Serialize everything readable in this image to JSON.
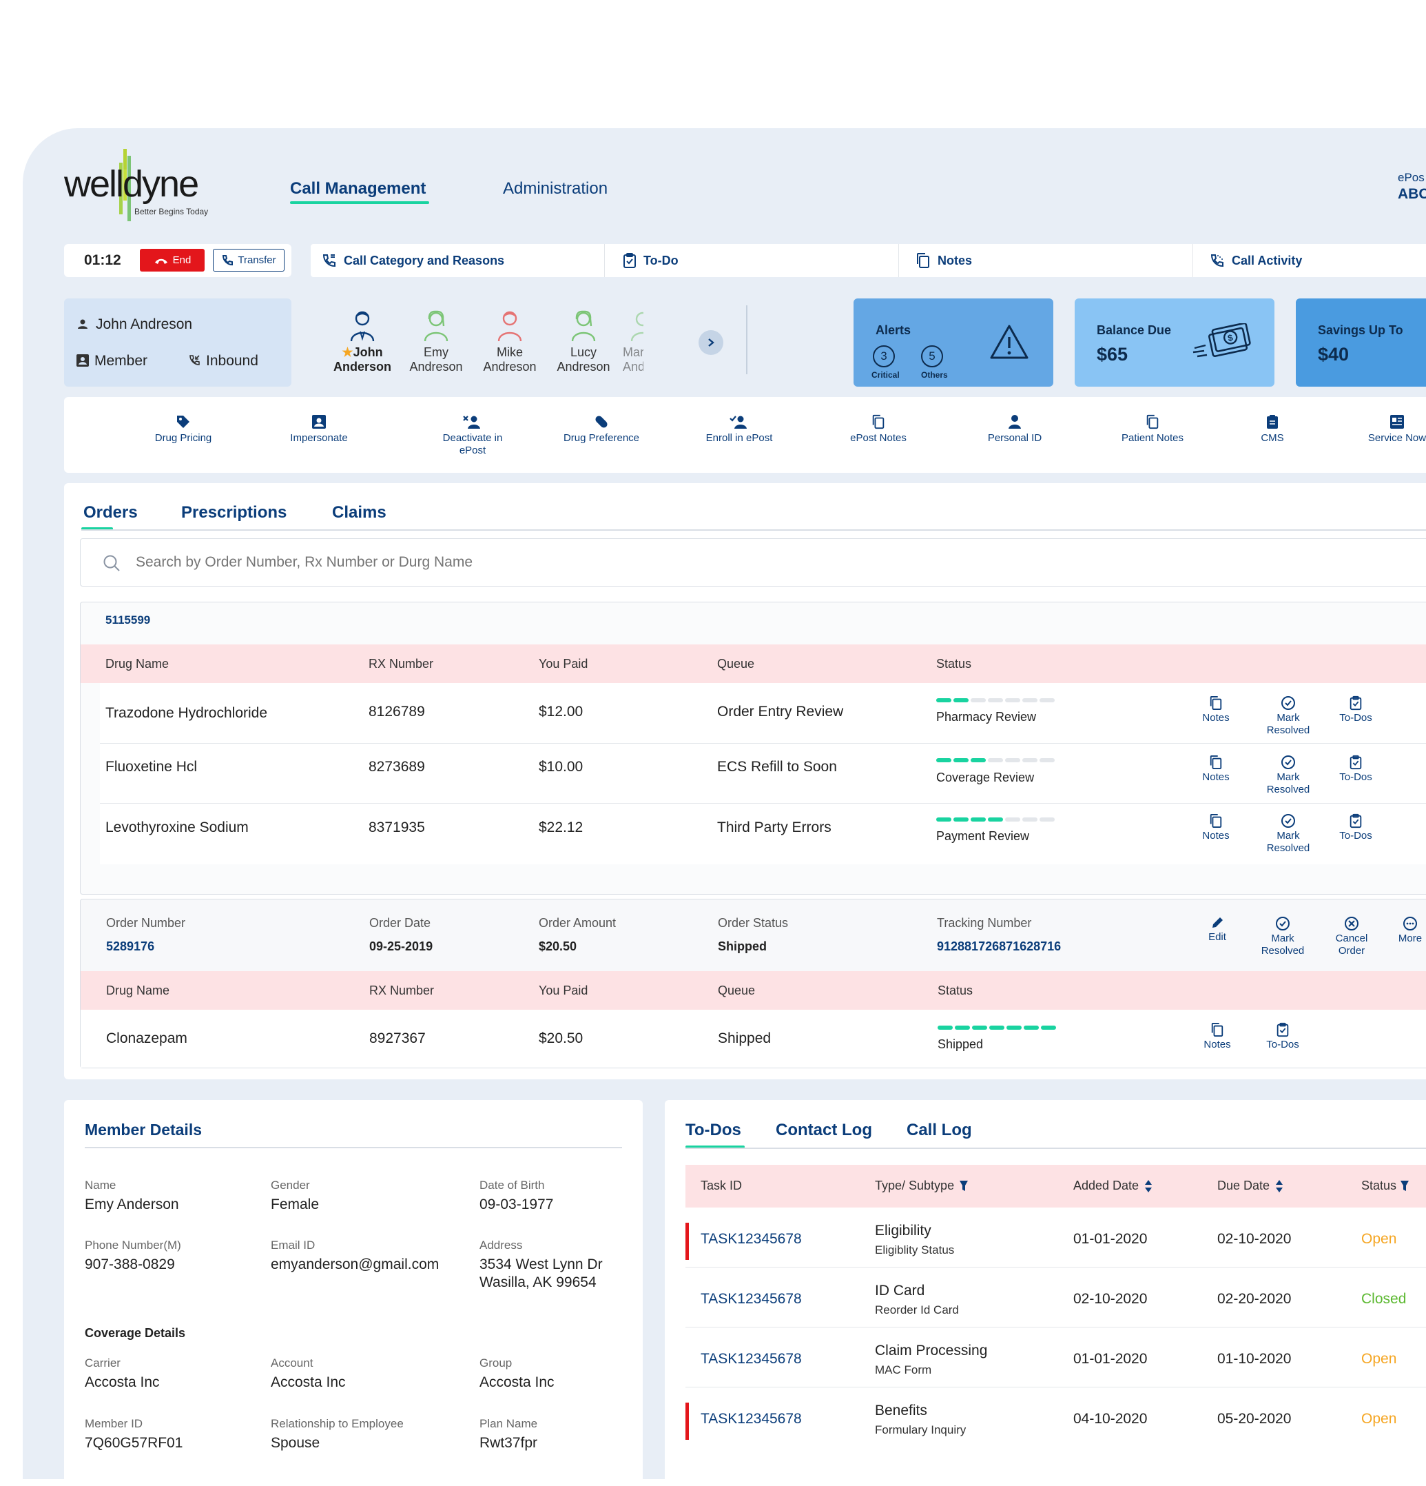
{
  "brand": {
    "name": "welldyne",
    "tagline": "Better Begins Today"
  },
  "nav": {
    "call_management": "Call Management",
    "administration": "Administration",
    "epost_label": "ePos",
    "epost_value": "ABC"
  },
  "call": {
    "timer": "01:12",
    "end": "End",
    "transfer": "Transfer"
  },
  "topbar": {
    "category": "Call Category and Reasons",
    "todo": "To-Do",
    "notes": "Notes",
    "activity": "Call Activity"
  },
  "caller": {
    "name": "John Andreson",
    "role": "Member",
    "direction": "Inbound"
  },
  "members": [
    {
      "first": "John",
      "last": "Anderson",
      "color": "#0b3d7a"
    },
    {
      "first": "Emy",
      "last": "Andreson",
      "color": "#7cc576"
    },
    {
      "first": "Mike",
      "last": "Andreson",
      "color": "#e57373"
    },
    {
      "first": "Lucy",
      "last": "Andreson",
      "color": "#7cc576"
    },
    {
      "first": "Mar",
      "last": "Andre",
      "color": "#b8dcae"
    }
  ],
  "alerts": {
    "title": "Alerts",
    "critical_count": "3",
    "critical_label": "Critical",
    "others_count": "5",
    "others_label": "Others"
  },
  "balance": {
    "title": "Balance Due",
    "amount": "$65"
  },
  "savings": {
    "title": "Savings Up To",
    "amount": "$40"
  },
  "actions": [
    "Drug Pricing",
    "Impersonate",
    "Deactivate in ePost",
    "Drug Preference",
    "Enroll in ePost",
    "ePost Notes",
    "Personal ID",
    "Patient Notes",
    "CMS",
    "Service Now"
  ],
  "tabs": {
    "orders": "Orders",
    "prescriptions": "Prescriptions",
    "claims": "Claims"
  },
  "search": {
    "placeholder": "Search by Order Number, Rx Number or Durg Name"
  },
  "table_headers": {
    "drug": "Drug Name",
    "rx": "RX Number",
    "paid": "You Paid",
    "queue": "Queue",
    "status": "Status"
  },
  "order1": {
    "number": "5115599",
    "rows": [
      {
        "drug": "Trazodone Hydrochloride",
        "rx": "8126789",
        "paid": "$12.00",
        "queue": "Order Entry Review",
        "status": "Pharmacy Review",
        "progress": 2
      },
      {
        "drug": "Fluoxetine Hcl",
        "rx": "8273689",
        "paid": "$10.00",
        "queue": "ECS Refill to Soon",
        "status": "Coverage Review",
        "progress": 3
      },
      {
        "drug": "Levothyroxine Sodium",
        "rx": "8371935",
        "paid": "$22.12",
        "queue": "Third Party Errors",
        "status": "Payment Review",
        "progress": 4
      }
    ]
  },
  "row_actions": {
    "notes": "Notes",
    "mark": "Mark",
    "resolved": "Resolved",
    "todos": "To-Dos"
  },
  "order2": {
    "labels": {
      "number": "Order Number",
      "date": "Order Date",
      "amount": "Order Amount",
      "status": "Order Status",
      "tracking": "Tracking Number"
    },
    "number": "5289176",
    "date": "09-25-2019",
    "amount": "$20.50",
    "status": "Shipped",
    "tracking": "912881726871628716",
    "actions": {
      "edit": "Edit",
      "cancel1": "Cancel",
      "cancel2": "Order",
      "more": "More"
    },
    "rows": [
      {
        "drug": "Clonazepam",
        "rx": "8927367",
        "paid": "$20.50",
        "queue": "Shipped",
        "status": "Shipped",
        "progress": 7
      }
    ]
  },
  "member_details": {
    "title": "Member Details",
    "fields": [
      {
        "label": "Name",
        "value": "Emy Anderson"
      },
      {
        "label": "Gender",
        "value": "Female"
      },
      {
        "label": "Date of Birth",
        "value": "09-03-1977"
      },
      {
        "label": "Phone Number(M)",
        "value": "907-388-0829"
      },
      {
        "label": "Email ID",
        "value": "emyanderson@gmail.com"
      },
      {
        "label": "Address",
        "value": "3534 West Lynn Dr",
        "value2": "Wasilla, AK 99654"
      }
    ],
    "coverage_title": "Coverage Details",
    "coverage": [
      {
        "label": "Carrier",
        "value": "Accosta Inc"
      },
      {
        "label": "Account",
        "value": "Accosta Inc"
      },
      {
        "label": "Group",
        "value": "Accosta Inc"
      },
      {
        "label": "Member ID",
        "value": "7Q60G57RF01"
      },
      {
        "label": "Relationship to Employee",
        "value": "Spouse"
      },
      {
        "label": "Plan Name",
        "value": "Rwt37fpr"
      }
    ]
  },
  "todos": {
    "tabs": {
      "todos": "To-Dos",
      "contact": "Contact Log",
      "call": "Call Log"
    },
    "headers": {
      "task": "Task ID",
      "type": "Type/ Subtype",
      "added": "Added Date",
      "due": "Due Date",
      "status": "Status"
    },
    "rows": [
      {
        "id": "TASK12345678",
        "type": "Eligibility",
        "subtype": "Eligiblity Status",
        "added": "01-01-2020",
        "due": "02-10-2020",
        "status": "Open",
        "flag": true
      },
      {
        "id": "TASK12345678",
        "type": "ID Card",
        "subtype": "Reorder Id Card",
        "added": "02-10-2020",
        "due": "02-20-2020",
        "status": "Closed",
        "flag": false
      },
      {
        "id": "TASK12345678",
        "type": "Claim Processing",
        "subtype": "MAC Form",
        "added": "01-01-2020",
        "due": "01-10-2020",
        "status": "Open",
        "flag": false
      },
      {
        "id": "TASK12345678",
        "type": "Benefits",
        "subtype": "Formulary Inquiry",
        "added": "04-10-2020",
        "due": "05-20-2020",
        "status": "Open",
        "flag": true
      }
    ]
  },
  "colors": {
    "navy": "#0b3d7a",
    "accent_green": "#19d3a0",
    "end_red": "#e3161b",
    "open": "#f5a623",
    "closed": "#5bb82f",
    "header_pink": "#fde2e4"
  }
}
